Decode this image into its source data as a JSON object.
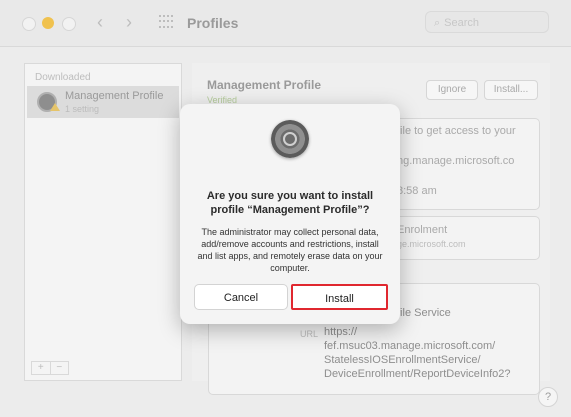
{
  "window": {
    "title": "Profiles",
    "search_placeholder": "Search"
  },
  "sidebar": {
    "section": "Downloaded",
    "item": {
      "name": "Management Profile",
      "subtitle": "1 setting"
    },
    "add": "+",
    "remove": "−"
  },
  "main": {
    "title": "Management Profile",
    "status": "Verified",
    "ignore_label": "Ignore",
    "install_label": "Install...",
    "desc_line1": "file to get access to your",
    "desc_line2": "ng.manage.microsoft.co",
    "desc_line3": "8:58 am",
    "enrol_title": "Enrolment",
    "enrol_sub": "ge.microsoft.com",
    "service": "file Service",
    "url_label": "URL",
    "url_lines": [
      "https://",
      "fef.msuc03.manage.microsoft.com/",
      "StatelessIOSEnrollmentService/",
      "DeviceEnrollment/ReportDeviceInfo2?"
    ]
  },
  "dialog": {
    "title": "Are you sure you want to install profile “Management Profile”?",
    "body": "The administrator may collect personal data, add/remove accounts and restrictions, install and list apps, and remotely erase data on your computer.",
    "cancel": "Cancel",
    "install": "Install"
  },
  "help": "?",
  "icons": {
    "dialog": "settings-gear-icon",
    "profile": "settings-gear-icon",
    "warning": "warning-triangle-icon",
    "back": "chevron-left-icon",
    "forward": "chevron-right-icon",
    "grid": "grid-icon",
    "search": "search-icon"
  },
  "colors": {
    "highlight": "#e0272f",
    "verified": "#b5cc9c"
  }
}
